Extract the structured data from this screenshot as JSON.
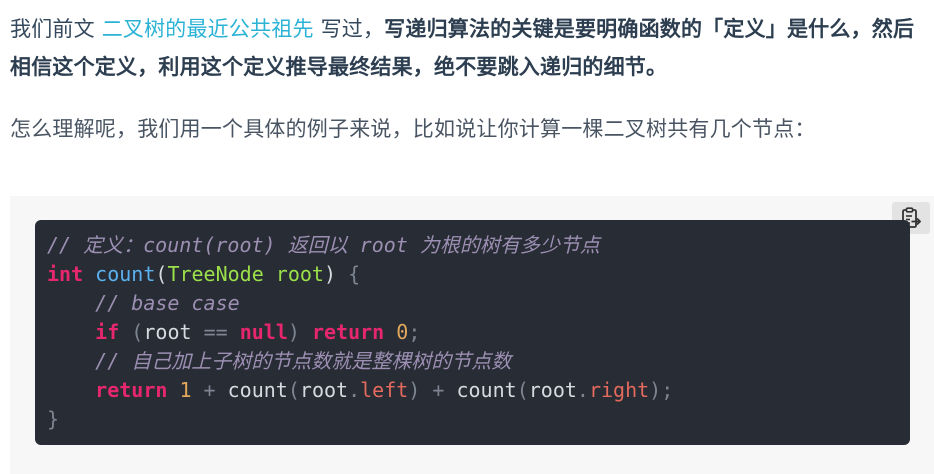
{
  "paragraph1": {
    "prefix": "我们前文 ",
    "link_text": "二叉树的最近公共祖先",
    "middle": " 写过，",
    "bold_text": "写递归算法的关键是要明确函数的「定义」是什么，然后相信这个定义，利用这个定义推导最终结果，绝不要跳入递归的细节。"
  },
  "paragraph2": {
    "text": "怎么理解呢，我们用一个具体的例子来说，比如说让你计算一棵二叉树共有几个节点："
  },
  "code": {
    "copy_icon": "clipboard-copy-icon",
    "line1_comment": "// 定义：count(root) 返回以 root 为根的树有多少节点",
    "line2": {
      "kw_int": "int",
      "fn_count": "count",
      "paren_open": "(",
      "type": "TreeNode",
      "param": " root",
      "paren_close": ")",
      "brace": " {"
    },
    "line3_comment": "// base case",
    "line4": {
      "kw_if": "if",
      "paren_open": " (",
      "var": "root",
      "op": " == ",
      "null": "null",
      "paren_close": ")",
      "kw_return": " return",
      "num": " 0",
      "semi": ";"
    },
    "line5_comment": "// 自己加上子树的节点数就是整棵树的节点数",
    "line6": {
      "kw_return": "return",
      "num": " 1",
      "plus1": " + ",
      "call1": "count",
      "p1": "(",
      "root1": "root",
      "dot1": ".",
      "left": "left",
      "p2": ")",
      "plus2": " + ",
      "call2": "count",
      "p3": "(",
      "root2": "root",
      "dot2": ".",
      "right": "right",
      "p4": ");"
    },
    "line7_brace": "}"
  },
  "colors": {
    "link": "#2bb3d6",
    "code_bg": "#282c34",
    "keyword": "#e6276e",
    "function": "#5ab1f0",
    "type": "#9be04a",
    "comment": "#9c8fb3",
    "number": "#e0a85c",
    "property": "#e46a5e"
  }
}
